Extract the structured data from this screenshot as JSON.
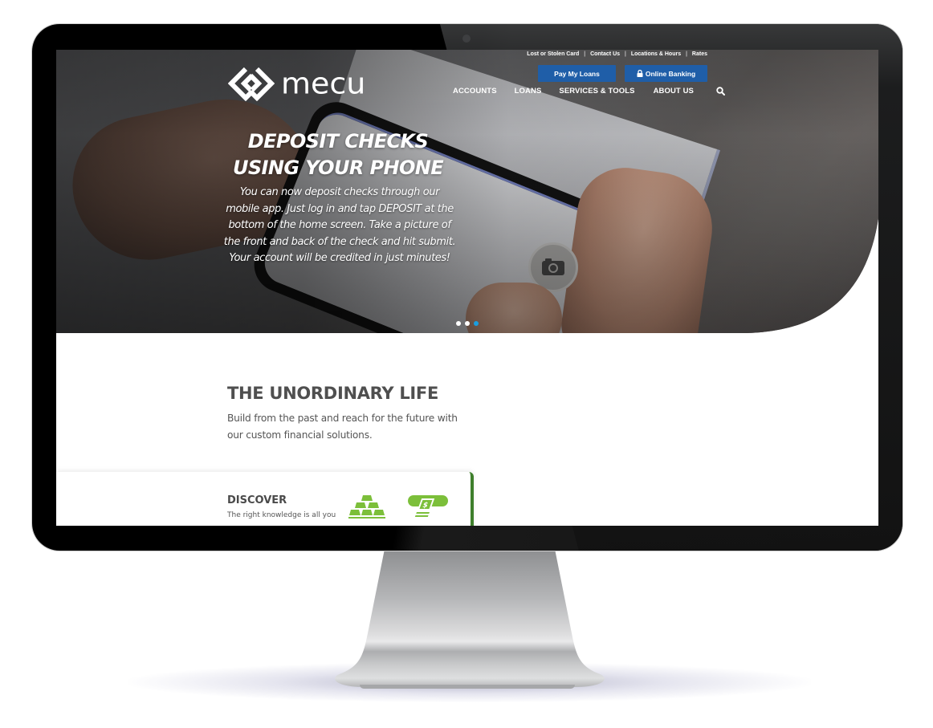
{
  "site": {
    "brand": "mecu",
    "utility_nav": [
      "Lost or Stolen Card",
      "Contact Us",
      "Locations & Hours",
      "Rates"
    ],
    "cta_buttons": {
      "pay_loans": "Pay My Loans",
      "online_banking": "Online Banking"
    },
    "main_nav": [
      "ACCOUNTS",
      "LOANS",
      "SERVICES & TOOLS",
      "ABOUT US"
    ],
    "search_icon": "search-icon"
  },
  "hero": {
    "title_line1": "DEPOSIT CHECKS",
    "title_line2": "USING YOUR PHONE",
    "body": "You can now deposit checks through our mobile app. Just log in and tap DEPOSIT at the bottom of the home screen. Take a picture of the front and back of the check and hit submit. Your account will be credited in just minutes!",
    "carousel": {
      "total_slides": 3,
      "active_slide": 3
    }
  },
  "content": {
    "section_title": "THE UNORDINARY LIFE",
    "section_subtitle": "Build from the past and reach for the future with our custom financial solutions.",
    "discover": {
      "title": "DISCOVER",
      "text": "The right knowledge is all you",
      "icons": [
        "gold-bars-icon",
        "cash-icon"
      ]
    }
  },
  "colors": {
    "cta_blue": "#1f5ea8",
    "carousel_active": "#1a9ee0",
    "accent_green": "#7cbf3a",
    "card_border_green": "#3f7f2c",
    "heading_gray": "#4f4f4f"
  }
}
